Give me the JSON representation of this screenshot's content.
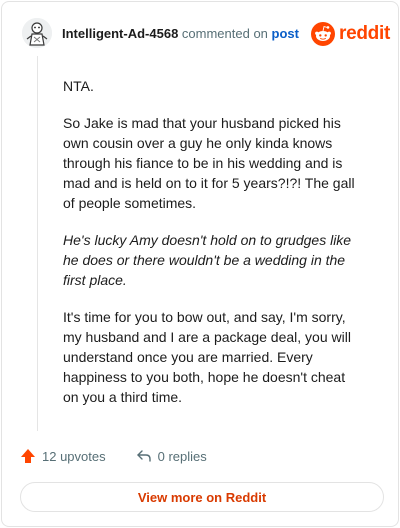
{
  "comment": {
    "username": "Intelligent-Ad-4568",
    "action": "commented on",
    "post_link": "post",
    "paragraphs": [
      "NTA.",
      "So Jake is mad that your husband picked his own cousin over a guy he only kinda knows through his fiance to be in his wedding and is mad and is held on to it for 5 years?!?! The gall of people sometimes.",
      "He's lucky Amy doesn't hold on to grudges like he does or there wouldn't be a wedding in the first place.",
      "It's time for you to bow out, and say, I'm sorry, my husband and I are a package deal, you will understand once you are married. Every happiness to you both, hope he doesn't cheat on you a third time."
    ]
  },
  "brand": {
    "name": "reddit",
    "icon": "reddit-logo-icon",
    "color": "#ff4500"
  },
  "footer": {
    "upvotes": "12 upvotes",
    "upvote_icon": "upvote-arrow-icon",
    "upvote_color": "#ff4500",
    "replies": "0 replies",
    "reply_icon": "reply-arrow-icon"
  },
  "view_more": {
    "label": "View more on Reddit",
    "color": "#d93a00"
  },
  "colors": {
    "link": "#0a5ec8",
    "muted": "#576f76",
    "border": "#e3e3e3"
  }
}
